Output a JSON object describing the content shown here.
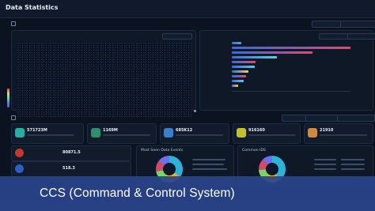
{
  "app": {
    "title": "Data Statistics"
  },
  "sections": {
    "top_label": "",
    "mid_label": "",
    "top_date_from": "",
    "top_date_to": "",
    "mid_date_from": "",
    "mid_date_to": ""
  },
  "left_panel": {
    "title": "",
    "select": ""
  },
  "right_panel": {
    "title": "",
    "select_a": "",
    "select_b": ""
  },
  "stat_cards": [
    {
      "value": "571723M",
      "icon_color": "#24b0a5"
    },
    {
      "value": "1169M",
      "icon_color": "#2a8f6a"
    },
    {
      "value": "685K12",
      "icon_color": "#3a7fcf"
    },
    {
      "value": "916160",
      "icon_color": "#c4bf2a"
    },
    {
      "value": "21910",
      "icon_color": "#d08a3a"
    }
  ],
  "small_cards": [
    {
      "label": "",
      "value": "80871.5"
    },
    {
      "label": "",
      "value": "518.3"
    }
  ],
  "donut_panels": [
    {
      "title": "Most Seen Data Events"
    },
    {
      "title": "Common IDS"
    }
  ],
  "caption": {
    "text": "CCS (Command & Control System)"
  },
  "colors": {
    "accent": "#2a448c",
    "background": "#0b1220"
  },
  "chart_data": {
    "type": "bar",
    "orientation": "horizontal",
    "categories": [
      "",
      "",
      "",
      "",
      "",
      "",
      "",
      "",
      "",
      ""
    ],
    "values": [
      8,
      100,
      68,
      38,
      20,
      19,
      14,
      12,
      10,
      5
    ],
    "xlim": [
      0,
      100
    ],
    "bar_colors": [
      "#5b9bff",
      "#ff3b6b",
      "#ff3b6b",
      "#3bd8ff",
      "#ff3b6b",
      "#3bd8ff",
      "#ffd23b",
      "#ff3b6b",
      "#3bd8ff",
      "#ffd23b"
    ]
  }
}
